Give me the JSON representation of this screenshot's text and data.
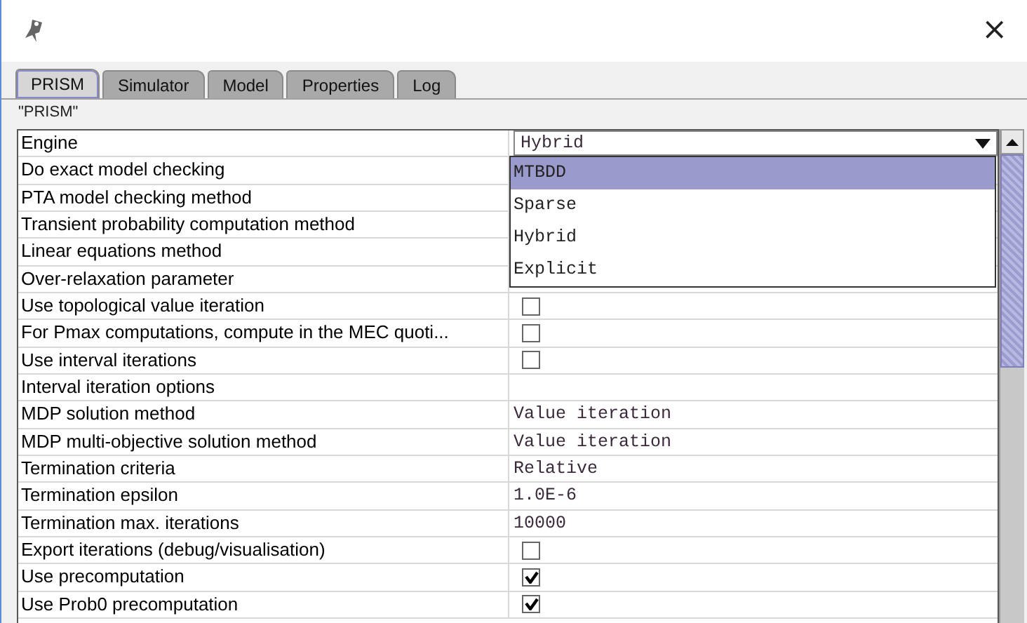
{
  "window": {
    "close": "×"
  },
  "tabs": [
    {
      "label": "PRISM",
      "selected": true
    },
    {
      "label": "Simulator",
      "selected": false
    },
    {
      "label": "Model",
      "selected": false
    },
    {
      "label": "Properties",
      "selected": false
    },
    {
      "label": "Log",
      "selected": false
    }
  ],
  "panel_title": "\"PRISM\"",
  "rows": [
    {
      "name": "Engine",
      "kind": "combo",
      "value": "Hybrid"
    },
    {
      "name": "Do exact model checking",
      "kind": "hidden"
    },
    {
      "name": "PTA model checking method",
      "kind": "hidden"
    },
    {
      "name": "Transient probability computation method",
      "kind": "hidden"
    },
    {
      "name": "Linear equations method",
      "kind": "hidden"
    },
    {
      "name": "Over-relaxation parameter",
      "kind": "hidden"
    },
    {
      "name": "Use topological value iteration",
      "kind": "check",
      "checked": false
    },
    {
      "name": "For Pmax computations, compute in the MEC quoti...",
      "kind": "check",
      "checked": false
    },
    {
      "name": "Use interval iterations",
      "kind": "check",
      "checked": false
    },
    {
      "name": "Interval iteration options",
      "kind": "empty"
    },
    {
      "name": "MDP solution method",
      "kind": "text",
      "value": "Value iteration"
    },
    {
      "name": "MDP multi-objective solution method",
      "kind": "text",
      "value": "Value iteration"
    },
    {
      "name": "Termination criteria",
      "kind": "text",
      "value": "Relative"
    },
    {
      "name": "Termination epsilon",
      "kind": "text",
      "value": "1.0E-6"
    },
    {
      "name": "Termination max. iterations",
      "kind": "text",
      "value": "10000"
    },
    {
      "name": "Export iterations (debug/visualisation)",
      "kind": "check",
      "checked": false
    },
    {
      "name": "Use precomputation",
      "kind": "check",
      "checked": true
    },
    {
      "name": "Use Prob0 precomputation",
      "kind": "check",
      "checked": true
    }
  ],
  "dropdown": {
    "options": [
      {
        "label": "MTBDD",
        "selected": true
      },
      {
        "label": "Sparse",
        "selected": false
      },
      {
        "label": "Hybrid",
        "selected": false
      },
      {
        "label": "Explicit",
        "selected": false
      }
    ]
  }
}
